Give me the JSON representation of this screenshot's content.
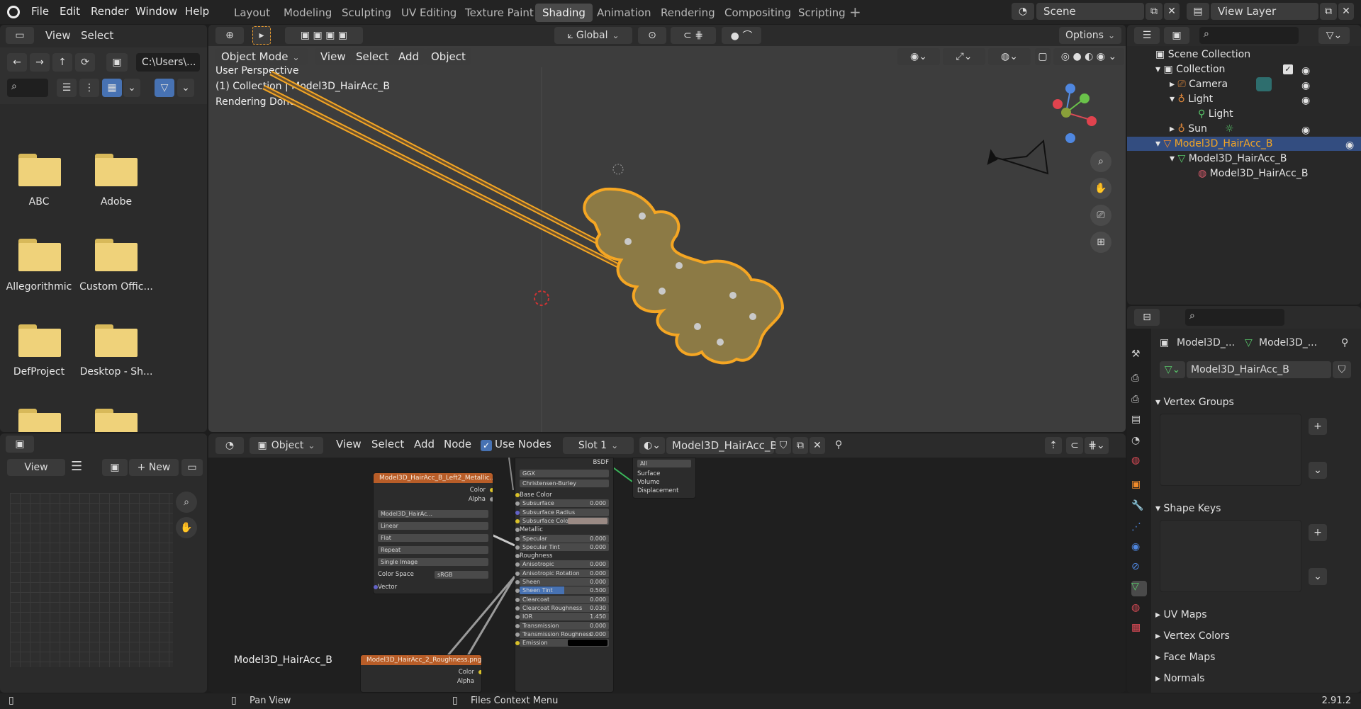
{
  "menubar": {
    "items": [
      "File",
      "Edit",
      "Render",
      "Window",
      "Help"
    ],
    "workspaces": [
      "Layout",
      "Modeling",
      "Sculpting",
      "UV Editing",
      "Texture Paint",
      "Shading",
      "Animation",
      "Rendering",
      "Compositing",
      "Scripting"
    ],
    "active_workspace": "Shading",
    "scene": "Scene",
    "view_layer": "View Layer"
  },
  "filebrowser": {
    "view": "View",
    "select": "Select",
    "path": "C:\\Users\\...",
    "folders": [
      "ABC",
      "Adobe",
      "Allegorithmic",
      "Custom Offic...",
      "DefProject",
      "Desktop - Sh...",
      "",
      ""
    ]
  },
  "imageeditor": {
    "view": "View",
    "new": "New"
  },
  "viewport": {
    "mode": "Object Mode",
    "menus": [
      "View",
      "Select",
      "Add",
      "Object"
    ],
    "transform": "Global",
    "options": "Options",
    "overlay_lines": [
      "User Perspective",
      "(1) Collection | Model3D_HairAcc_B",
      "Rendering Done"
    ]
  },
  "nodeeditor": {
    "type": "Object",
    "menus": [
      "View",
      "Select",
      "Add",
      "Node"
    ],
    "use_nodes": "Use Nodes",
    "slot": "Slot 1",
    "material": "Model3D_HairAcc_B",
    "label": "Model3D_HairAcc_B",
    "tex1": {
      "title": "Model3D_HairAcc_B_Left2_Metallic...",
      "out": [
        "Color",
        "Alpha"
      ],
      "img": "Model3D_HairAc...",
      "fields": [
        "Linear",
        "Flat",
        "Repeat",
        "Single Image"
      ],
      "colorspace_label": "Color Space",
      "colorspace": "sRGB",
      "vector": "Vector"
    },
    "tex2": {
      "title": "Model3D_HairAcc_2_Roughness.png",
      "out": [
        "Color",
        "Alpha"
      ]
    },
    "bsdf": {
      "top": "BSDF",
      "dist": "GGX",
      "sss": "Christensen-Burley",
      "rows": [
        [
          "Base Color",
          ""
        ],
        [
          "Subsurface",
          "0.000"
        ],
        [
          "Subsurface Radius",
          ""
        ],
        [
          "Subsurface Color",
          ""
        ],
        [
          "Metallic",
          ""
        ],
        [
          "Specular",
          "0.000"
        ],
        [
          "Specular Tint",
          "0.000"
        ],
        [
          "Roughness",
          ""
        ],
        [
          "Anisotropic",
          "0.000"
        ],
        [
          "Anisotropic Rotation",
          "0.000"
        ],
        [
          "Sheen",
          "0.000"
        ],
        [
          "Sheen Tint",
          "0.500"
        ],
        [
          "Clearcoat",
          "0.000"
        ],
        [
          "Clearcoat Roughness",
          "0.030"
        ],
        [
          "IOR",
          "1.450"
        ],
        [
          "Transmission",
          "0.000"
        ],
        [
          "Transmission Roughness",
          "0.000"
        ],
        [
          "Emission",
          ""
        ]
      ]
    },
    "output": {
      "target": "All",
      "rows": [
        "Surface",
        "Volume",
        "Displacement"
      ]
    }
  },
  "outliner": {
    "items": [
      {
        "label": "Scene Collection"
      },
      {
        "label": "Collection"
      },
      {
        "label": "Camera"
      },
      {
        "label": "Light"
      },
      {
        "label": "Light"
      },
      {
        "label": "Sun"
      },
      {
        "label": "Model3D_HairAcc_B"
      },
      {
        "label": "Model3D_HairAcc_B"
      },
      {
        "label": "Model3D_HairAcc_B"
      }
    ]
  },
  "properties": {
    "obj_short": "Model3D_...",
    "data_short": "Model3D_...",
    "mesh_name": "Model3D_HairAcc_B",
    "sections": [
      "Vertex Groups",
      "Shape Keys",
      "UV Maps",
      "Vertex Colors",
      "Face Maps",
      "Normals"
    ]
  },
  "status": {
    "pan": "Pan View",
    "ctx": "Files Context Menu",
    "version": "2.91.2"
  },
  "colors": {
    "accent": "#4772b3",
    "orange": "#f5a623",
    "active_row": "#334d80"
  }
}
